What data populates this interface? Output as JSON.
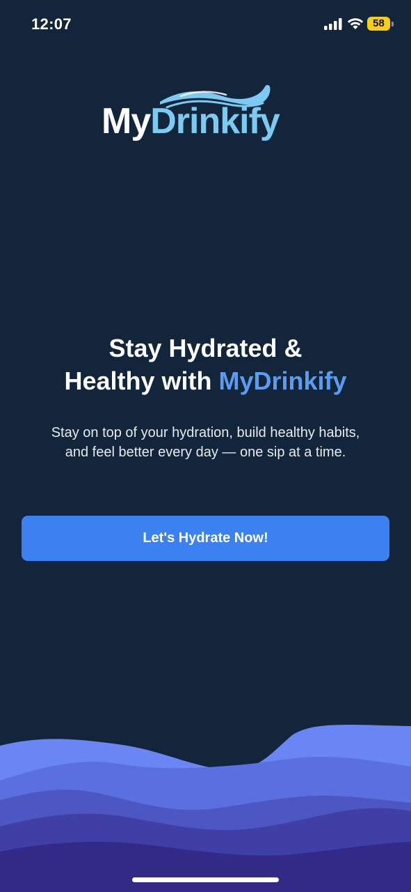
{
  "status_bar": {
    "time": "12:07",
    "battery_level": "58",
    "icons": [
      "signal-icon",
      "wifi-icon",
      "battery-icon"
    ]
  },
  "logo": {
    "part1": "My",
    "part2": "Drinkify"
  },
  "headline": {
    "line1": "Stay Hydrated &",
    "line2_prefix": "Healthy with ",
    "line2_accent": "MyDrinkify"
  },
  "subtitle": {
    "line1": "Stay on top of your hydration, build healthy habits,",
    "line2": "and feel better every day — one sip at a time."
  },
  "cta": {
    "label": "Let's Hydrate Now!"
  },
  "colors": {
    "background": "#13253b",
    "accent": "#3b82f0",
    "headline_accent": "#5a9cf0",
    "logo_accent": "#7cc9f2",
    "battery": "#f5cc1f",
    "waves": [
      "#6a86f5",
      "#5a6fe0",
      "#4c57c4",
      "#3f3fa6",
      "#332a88"
    ]
  }
}
